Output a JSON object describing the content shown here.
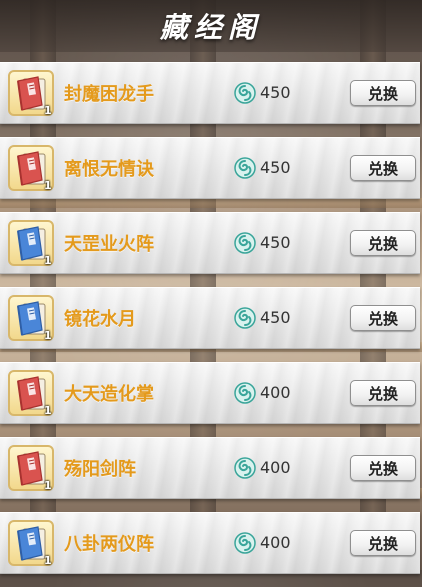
{
  "header": {
    "title": "藏经阁"
  },
  "colors": {
    "item_name": "#e49a1c",
    "red_book": "#d9534f",
    "blue_book": "#4a86d8",
    "currency": "#3aa59a"
  },
  "currency_icon": "jade-spiral-icon",
  "items": [
    {
      "name": "封魔困龙手",
      "price": "450",
      "count": "1",
      "book_icon": "red-book-icon",
      "button": "兑换"
    },
    {
      "name": "离恨无情诀",
      "price": "450",
      "count": "1",
      "book_icon": "red-book-icon",
      "button": "兑换"
    },
    {
      "name": "天罡业火阵",
      "price": "450",
      "count": "1",
      "book_icon": "blue-book-icon",
      "button": "兑换"
    },
    {
      "name": "镜花水月",
      "price": "450",
      "count": "1",
      "book_icon": "blue-book-icon",
      "button": "兑换"
    },
    {
      "name": "大天造化掌",
      "price": "400",
      "count": "1",
      "book_icon": "red-book-icon",
      "button": "兑换"
    },
    {
      "name": "殇阳剑阵",
      "price": "400",
      "count": "1",
      "book_icon": "red-book-icon",
      "button": "兑换"
    },
    {
      "name": "八卦两仪阵",
      "price": "400",
      "count": "1",
      "book_icon": "blue-book-icon",
      "button": "兑换"
    }
  ]
}
